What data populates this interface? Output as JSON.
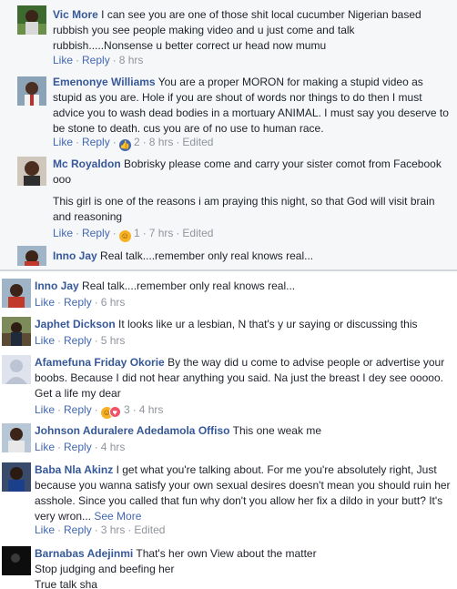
{
  "comments_top": [
    {
      "name": "Vic More",
      "text": "I can see you are one of those shit local cucumber Nigerian based rubbish you see people making video and u just come and talk rubbish.....Nonsense u better correct ur head now mumu",
      "like": "Like",
      "reply": "Reply",
      "time": "8 hrs"
    },
    {
      "name": "Emenonye Williams",
      "text": "You are a proper MORON for making a stupid video as stupid as you are. Hole if you are shout of words nor things to do then I must advice you to wash dead bodies in a mortuary ANIMAL. I must say you deserve to be stone to death. cus you are of no use to human race.",
      "like": "Like",
      "reply": "Reply",
      "reaction_count": "2",
      "time": "8 hrs",
      "edited": "Edited"
    },
    {
      "name": "Mc Royaldon",
      "text": "Bobrisky please come and carry your sister comot from Facebook ooo",
      "text2": "This girl is one of the reasons i am praying this night, so that God will visit brain and reasoning",
      "like": "Like",
      "reply": "Reply",
      "reaction_count": "1",
      "time": "7 hrs",
      "edited": "Edited"
    },
    {
      "name": "Inno Jay",
      "text": "Real talk....remember only real knows real..."
    }
  ],
  "comments_bottom": [
    {
      "name": "Inno Jay",
      "text": "Real talk....remember only real knows real...",
      "like": "Like",
      "reply": "Reply",
      "time": "6 hrs"
    },
    {
      "name": "Japhet Dickson",
      "text": "It looks like ur a lesbian, N that's y ur saying or discussing this",
      "like": "Like",
      "reply": "Reply",
      "time": "5 hrs"
    },
    {
      "name": "Afamefuna Friday Okorie",
      "text": "By the way did u come to advise people or advertise your boobs. Because I did not hear anything you said. Na just the breast I dey see ooooo. Get a life my dear",
      "like": "Like",
      "reply": "Reply",
      "reaction_count": "3",
      "time": "4 hrs"
    },
    {
      "name": "Johnson Aduralere Adedamola Offiso",
      "text": "This one weak me",
      "like": "Like",
      "reply": "Reply",
      "time": "4 hrs"
    },
    {
      "name": "Baba Nla Akinz",
      "text": "I get what you're talking about. For me you're absolutely right, Just because you wanna satisfy your own sexual desires doesn't mean you should ruin her asshole. Since you called that fun why don't you allow her fix a dildo in your butt? It's very wron...",
      "see_more": "See More",
      "like": "Like",
      "reply": "Reply",
      "time": "3 hrs",
      "edited": "Edited"
    },
    {
      "name": "Barnabas Adejinmi",
      "text": "That's her own View about the matter",
      "text2": "Stop judging and beefing her",
      "text3": "True talk sha"
    }
  ],
  "colors": {
    "name_link": "#365899",
    "action_link": "#4267b2",
    "meta_gray": "#90949c",
    "like_reaction": "#4267b2",
    "haha_reaction": "#f7b125",
    "love_reaction": "#f25268"
  },
  "icons": {
    "like_reaction": "thumbs-up-icon",
    "haha_reaction": "laughing-face-icon",
    "love_reaction": "heart-icon"
  }
}
